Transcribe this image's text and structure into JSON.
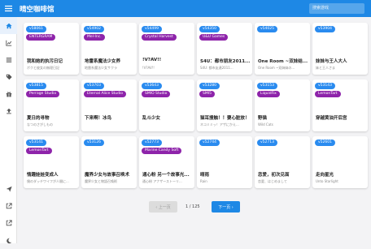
{
  "app": {
    "title": "晴空咖啡馆",
    "search_placeholder": "搜索游戏"
  },
  "colors": {
    "primary": "#1e88e5",
    "id_badge": "#2a8bef",
    "tag_badge": "#8e24aa"
  },
  "sidebar": {
    "items": [
      {
        "icon": "home-icon",
        "active": true
      },
      {
        "icon": "chart-icon"
      },
      {
        "icon": "list-icon"
      },
      {
        "icon": "tag-icon"
      },
      {
        "icon": "gift-icon"
      },
      {
        "icon": "upload-icon"
      },
      {
        "icon": "send-icon"
      },
      {
        "icon": "external-link-icon"
      },
      {
        "icon": "external-link-icon"
      },
      {
        "icon": "dark-mode-icon"
      }
    ]
  },
  "cards": [
    {
      "id": "v58061",
      "tag": "ENTERGRAM",
      "title": "我和她的执污日记",
      "subtitle": "ボクと彼女の無理日記"
    },
    {
      "id": "v54902",
      "tag": "Mel-Inc.",
      "title": "地雷系魔法少女养",
      "subtitle": "地雷系魔法少女サクラ"
    },
    {
      "id": "v54499",
      "tag": "Crystal Harvest",
      "title": "!V?AV!!",
      "subtitle": "!V?AV!!"
    },
    {
      "id": "v54350",
      "tag": "U&U Games",
      "title": "S4U：都市朋友2011...",
      "subtitle": "S4U: 都市友達2011..."
    },
    {
      "id": "v54025",
      "tag": "",
      "title": "One Room ~双妹结...",
      "subtitle": "One Room ~双姉妹の..."
    },
    {
      "id": "v53904",
      "tag": "",
      "title": "妹妹与王人大人",
      "subtitle": "妹と王人さま"
    },
    {
      "id": "v53815",
      "tag": "Perrage Studio",
      "title": "夏日的寻物",
      "subtitle": "なつのさがしもの"
    },
    {
      "id": "v53703",
      "tag": "Eternal Alice Studio",
      "title": "下来啊！冰鸟",
      "subtitle": ""
    },
    {
      "id": "v53643",
      "tag": "SMIO Studio",
      "title": "乱斗少女",
      "subtitle": ""
    },
    {
      "id": "v53280",
      "tag": "SMI5",
      "title": "猫耳搜触！！要心脏放！",
      "subtitle": "ネコミミッ！アザにかえ..."
    },
    {
      "id": "v53153",
      "tag": "LiquidFix",
      "title": "野猫",
      "subtitle": "Wild Cats"
    },
    {
      "id": "v53143",
      "tag": "LemonTart",
      "title": "穿越黄油开后宫",
      "subtitle": ""
    },
    {
      "id": "v53141",
      "tag": "LemonTart",
      "title": "情趣娃娃变成人",
      "subtitle": "僕のダッチワイフが人間に..."
    },
    {
      "id": "v53126",
      "tag": "",
      "title": "魔界少女与故事召唤术",
      "subtitle": "魔界少女と物語召喚術"
    },
    {
      "id": "v52773",
      "tag": "Marine Candy Soft",
      "title": "通心粉 另一个故事光...",
      "subtitle": "通心粉 アナザーストーリ..."
    },
    {
      "id": "v52744",
      "tag": "",
      "title": "晴雨",
      "subtitle": "Rain"
    },
    {
      "id": "v52713",
      "tag": "",
      "title": "恋爱，初次见面",
      "subtitle": "恋愛、はじめまして"
    },
    {
      "id": "v52601",
      "tag": "",
      "title": "走向星光",
      "subtitle": "Unto Starlight"
    }
  ],
  "pagination": {
    "prev_label": "‹ 上一页",
    "page_info": "1 / 125",
    "next_label": "下一页 ›"
  }
}
